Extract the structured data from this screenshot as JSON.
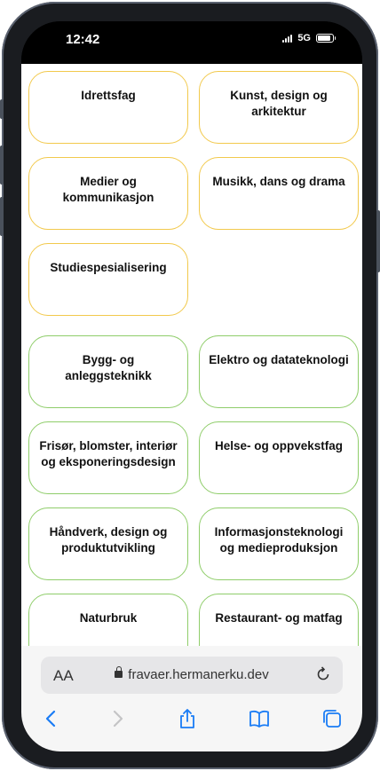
{
  "status_bar": {
    "time": "12:42",
    "network": "5G"
  },
  "cards": [
    {
      "label": "Idrettsfag",
      "color": "yellow"
    },
    {
      "label": "Kunst, design og arkitektur",
      "color": "yellow"
    },
    {
      "label": "Medier og kommunikasjon",
      "color": "yellow"
    },
    {
      "label": "Musikk, dans og drama",
      "color": "yellow"
    },
    {
      "label": "Studiespesialisering",
      "color": "yellow"
    },
    {
      "label": "Bygg- og anleggsteknikk",
      "color": "green"
    },
    {
      "label": "Elektro og datateknologi",
      "color": "green"
    },
    {
      "label": "Frisør, blomster, interiør og eksponeringsdesign",
      "color": "green"
    },
    {
      "label": "Helse- og oppvekstfag",
      "color": "green"
    },
    {
      "label": "Håndverk, design og produktutvikling",
      "color": "green"
    },
    {
      "label": "Informasjonsteknologi og medieproduksjon",
      "color": "green"
    },
    {
      "label": "Naturbruk",
      "color": "green"
    },
    {
      "label": "Restaurant- og matfag",
      "color": "green"
    }
  ],
  "colors": {
    "yellow": "#f2c94c",
    "green": "#8fcd6a",
    "accent": "#1a7cf5"
  },
  "browser": {
    "aa_label": "AA",
    "url": "fravaer.hermanerku.dev",
    "toolbar": [
      "back-icon",
      "forward-icon",
      "share-icon",
      "bookmarks-icon",
      "tabs-icon"
    ]
  }
}
